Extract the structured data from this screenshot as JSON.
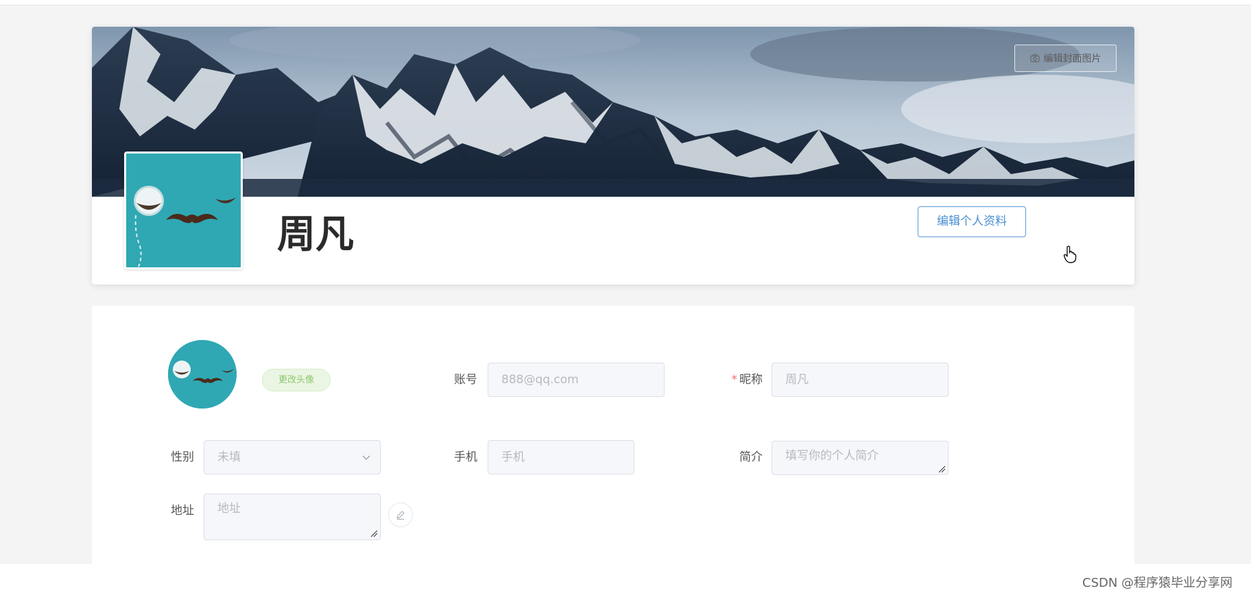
{
  "header": {
    "edit_cover_label": "编辑封面图片",
    "username": "周凡",
    "edit_profile_label": "编辑个人资料"
  },
  "form": {
    "change_avatar_label": "更改头像",
    "account": {
      "label": "账号",
      "placeholder": "888@qq.com"
    },
    "nickname": {
      "required_mark": "*",
      "label": "昵称",
      "placeholder": "周凡"
    },
    "gender": {
      "label": "性别",
      "selected": "未填"
    },
    "phone": {
      "label": "手机",
      "placeholder": "手机"
    },
    "bio": {
      "label": "简介",
      "placeholder": "填写你的个人简介"
    },
    "address": {
      "label": "地址",
      "placeholder": "地址"
    }
  },
  "watermark": "CSDN @程序猿毕业分享网",
  "colors": {
    "accent": "#4a8fd0",
    "avatar_bg": "#2fa8b4",
    "change_avatar_bg": "#eaf6e3",
    "required": "#f56c6c"
  },
  "icons": [
    "camera-icon",
    "cursor-hand-icon",
    "chevron-down-icon",
    "pencil-icon",
    "resize-grip-icon"
  ]
}
